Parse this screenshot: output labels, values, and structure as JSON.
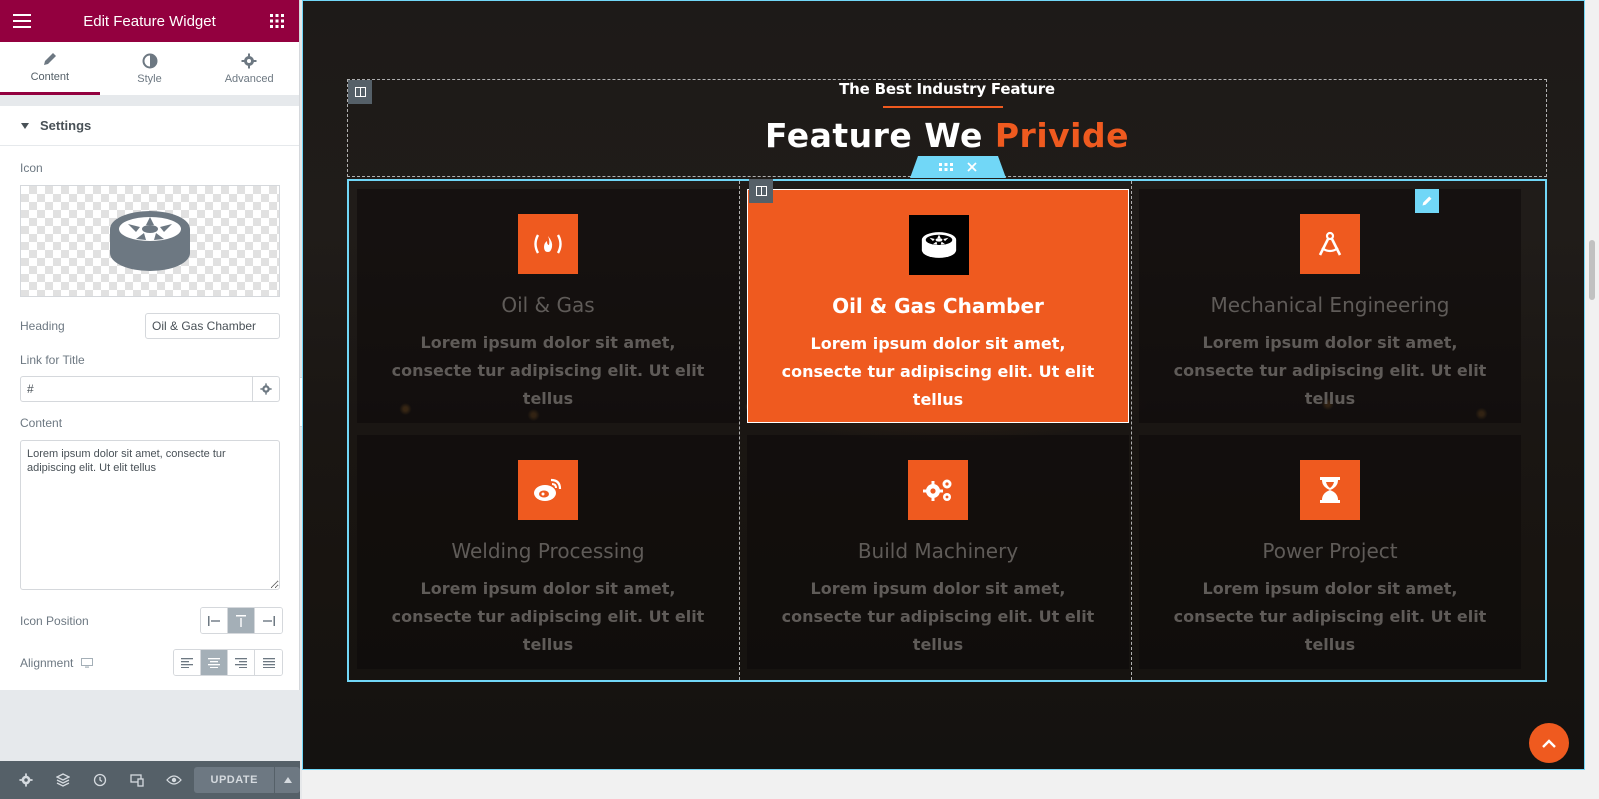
{
  "panel": {
    "title": "Edit Feature Widget",
    "tabs": [
      {
        "label": "Content",
        "icon": "pencil-icon"
      },
      {
        "label": "Style",
        "icon": "half-circle-icon"
      },
      {
        "label": "Advanced",
        "icon": "gear-icon"
      }
    ],
    "section_title": "Settings",
    "controls": {
      "icon_label": "Icon",
      "heading_label": "Heading",
      "heading_value": "Oil & Gas Chamber",
      "link_label": "Link for Title",
      "link_value": "#",
      "content_label": "Content",
      "content_value": "Lorem ipsum dolor sit amet, consecte tur adipiscing elit. Ut elit tellus",
      "icon_position_label": "Icon Position",
      "alignment_label": "Alignment"
    },
    "footer": {
      "update_label": "UPDATE"
    }
  },
  "preview": {
    "sub_heading": "The Best Industry Feature",
    "title_main": "Feature We ",
    "title_accent": "Privide",
    "features": [
      {
        "title": "Oil & Gas",
        "text": "Lorem ipsum dolor sit amet, consecte tur adipiscing elit. Ut elit tellus",
        "icon": "fire-icon"
      },
      {
        "title": "Oil & Gas Chamber",
        "text": "Lorem ipsum dolor sit amet, consecte tur adipiscing elit. Ut elit tellus",
        "icon": "wheel-icon"
      },
      {
        "title": "Mechanical Engineering",
        "text": "Lorem ipsum dolor sit amet, consecte tur adipiscing elit. Ut elit tellus",
        "icon": "compass-icon"
      },
      {
        "title": "Welding Processing",
        "text": "Lorem ipsum dolor sit amet, consecte tur adipiscing elit. Ut elit tellus",
        "icon": "weibo-icon"
      },
      {
        "title": "Build Machinery",
        "text": "Lorem ipsum dolor sit amet, consecte tur adipiscing elit. Ut elit tellus",
        "icon": "cogs-icon"
      },
      {
        "title": "Power Project",
        "text": "Lorem ipsum dolor sit amet, consecte tur adipiscing elit. Ut elit tellus",
        "icon": "hourglass-icon"
      }
    ]
  },
  "colors": {
    "panel_header": "#93003f",
    "accent": "#ef5a1f",
    "editor_highlight": "#71d7f7"
  }
}
